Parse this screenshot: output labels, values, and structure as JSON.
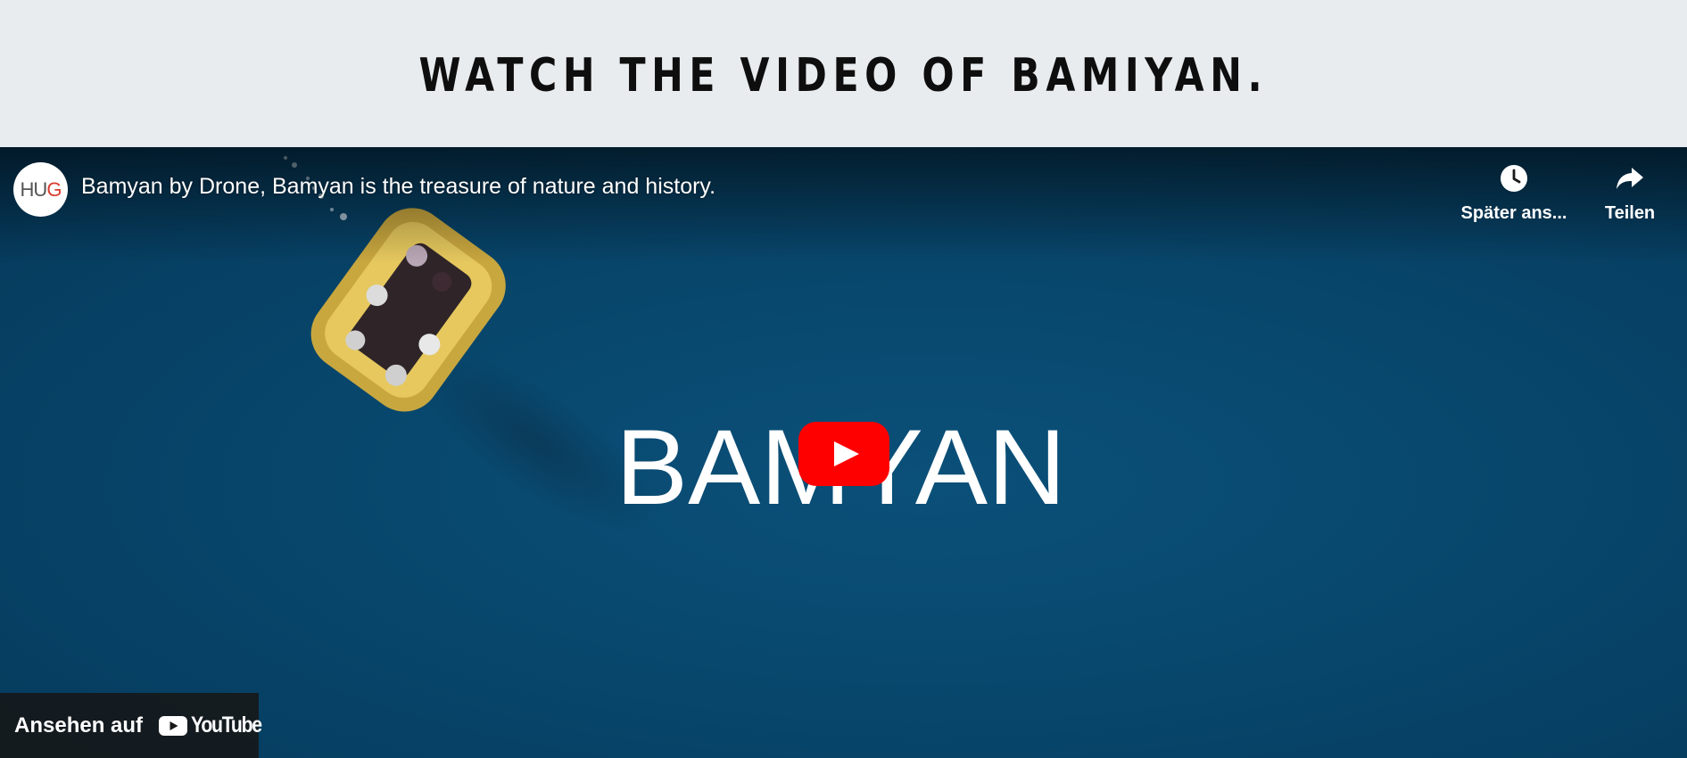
{
  "section": {
    "heading": "WATCH THE VIDEO OF BAMIYAN."
  },
  "video": {
    "title": "Bamyan by Drone, Bamyan is the treasure of nature and history.",
    "thumbnail_text": "BAMYAN",
    "channel": {
      "avatar_letters": "HU",
      "avatar_accent_letter": "G"
    },
    "actions": {
      "watch_later_label": "Später ans...",
      "share_label": "Teilen"
    },
    "watch_on": {
      "label": "Ansehen auf",
      "brand": "YouTube"
    }
  },
  "icons": {
    "watch_later": "clock-icon",
    "share": "share-arrow-icon",
    "play": "play-icon",
    "brand": "youtube-logo-icon"
  },
  "colors": {
    "page_background": "#e8ecef",
    "video_water": "#08486e",
    "youtube_red": "#ff0000",
    "raft_yellow": "#e0c25a"
  }
}
